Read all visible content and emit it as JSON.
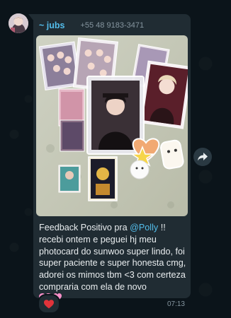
{
  "message": {
    "sender_name": "~ jubs",
    "sender_phone": "+55 48 9183-3471",
    "text_before_mention": "Feedback Positivo pra ",
    "mention": "@Polly",
    "text_after_mention": " !! recebi ontem e peguei hj meu photocard do sunwoo super lindo, foi super paciente e super honesta cmg, adorei os mimos tbm <3 com certeza compraria com ela de novo",
    "time": "07:13"
  },
  "reaction": {
    "icon": "red-heart-icon"
  },
  "icons": {
    "forward": "forward-share-icon",
    "hearts": "two-pink-hearts-icon"
  },
  "colors": {
    "background": "#0b141a",
    "bubble": "#202c33",
    "sender_name": "#53bdeb",
    "mention": "#53bdeb",
    "text": "#e9edef",
    "meta": "#8696a0"
  }
}
